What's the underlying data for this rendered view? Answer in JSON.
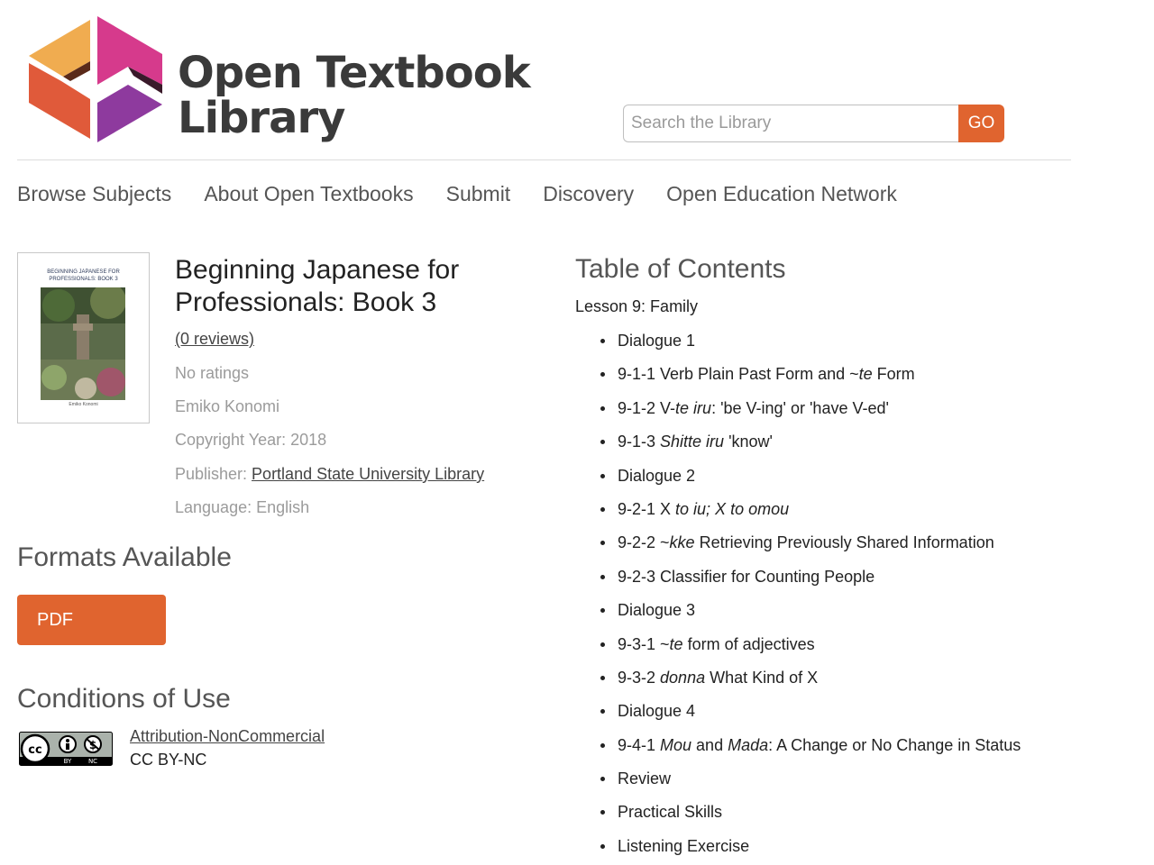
{
  "header": {
    "logo_line1": "Open Textbook",
    "logo_line2": "Library",
    "search_placeholder": "Search the Library",
    "go_label": "GO"
  },
  "nav": [
    "Browse Subjects",
    "About Open Textbooks",
    "Submit",
    "Discovery",
    "Open Education Network"
  ],
  "book": {
    "cover_title": "BEGINNING JAPANESE FOR PROFESSIONALS: BOOK 3",
    "cover_author": "Emiko Konomi",
    "title": "Beginning Japanese for Professionals: Book 3",
    "reviews": "(0 reviews)",
    "ratings": "No ratings",
    "author": "Emiko Konomi",
    "copyright": "Copyright Year: 2018",
    "publisher_label": "Publisher: ",
    "publisher": "Portland State University Library",
    "language": "Language: English"
  },
  "formats": {
    "heading": "Formats Available",
    "pdf_label": "PDF"
  },
  "conditions": {
    "heading": "Conditions of Use",
    "license_name": "Attribution-NonCommercial",
    "license_code": "CC BY-NC",
    "badge_text_by": "BY",
    "badge_text_nc": "NC"
  },
  "toc": {
    "heading": "Table of Contents",
    "lesson": "Lesson 9: Family",
    "items": [
      [
        {
          "t": "Dialogue 1"
        }
      ],
      [
        {
          "t": "9-1-1 Verb Plain Past Form and ~"
        },
        {
          "t": "te",
          "i": true
        },
        {
          "t": " Form"
        }
      ],
      [
        {
          "t": "9-1-2 V-"
        },
        {
          "t": "te iru",
          "i": true
        },
        {
          "t": ": 'be V-ing' or 'have V-ed'"
        }
      ],
      [
        {
          "t": "9-1-3 "
        },
        {
          "t": "Shitte iru",
          "i": true
        },
        {
          "t": " 'know'"
        }
      ],
      [
        {
          "t": "Dialogue 2"
        }
      ],
      [
        {
          "t": "9-2-1 X "
        },
        {
          "t": "to iu; X to omou",
          "i": true
        }
      ],
      [
        {
          "t": "9-2-2 ~"
        },
        {
          "t": "kke",
          "i": true
        },
        {
          "t": " Retrieving Previously Shared Information"
        }
      ],
      [
        {
          "t": "9-2-3 Classifier for Counting People"
        }
      ],
      [
        {
          "t": "Dialogue 3"
        }
      ],
      [
        {
          "t": "9-3-1 ~"
        },
        {
          "t": "te",
          "i": true
        },
        {
          "t": " form of adjectives"
        }
      ],
      [
        {
          "t": "9-3-2 "
        },
        {
          "t": "donna",
          "i": true
        },
        {
          "t": " What Kind of X"
        }
      ],
      [
        {
          "t": "Dialogue 4"
        }
      ],
      [
        {
          "t": "9-4-1 "
        },
        {
          "t": "Mou",
          "i": true
        },
        {
          "t": " and "
        },
        {
          "t": "Mada",
          "i": true
        },
        {
          "t": ": A Change or No Change in Status"
        }
      ],
      [
        {
          "t": "Review"
        }
      ],
      [
        {
          "t": "Practical Skills"
        }
      ],
      [
        {
          "t": "Listening Exercise"
        }
      ]
    ]
  },
  "colors": {
    "accent": "#e0642f",
    "logo_orange": "#f0a64a",
    "logo_pink": "#d63a8c",
    "logo_red": "#e05a3a",
    "logo_purple": "#8e3a9e"
  }
}
